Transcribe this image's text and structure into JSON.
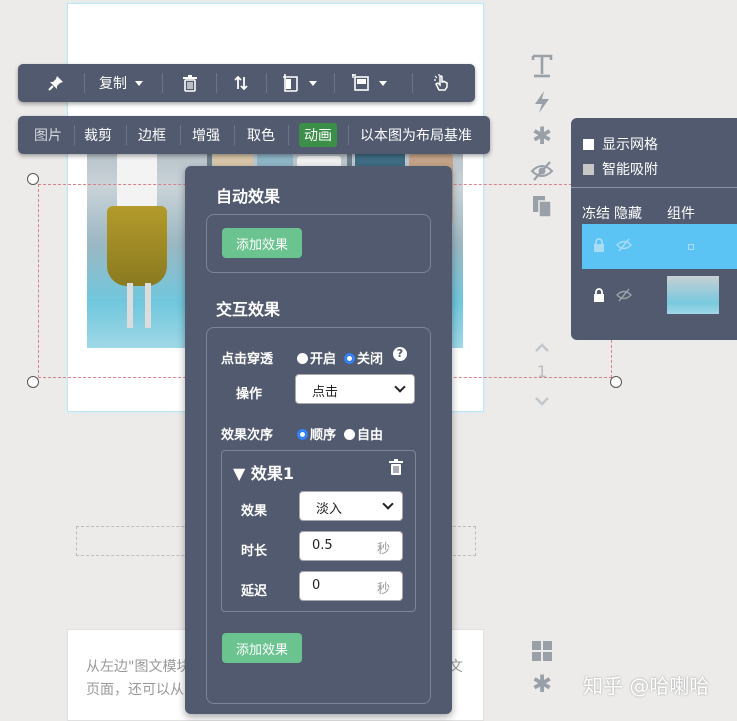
{
  "toolbar_top": {
    "pin_icon": "pin-icon",
    "copy_label": "复制",
    "delete_icon": "trash-icon",
    "order_icon": "sort-arrows-icon",
    "align_icon": "align-icon",
    "size_icon": "size-icon",
    "interact_icon": "hand-pointer-icon"
  },
  "toolbar_tabs": {
    "items": [
      "图片",
      "裁剪",
      "边框",
      "增强",
      "取色",
      "动画",
      "以本图为布局基准"
    ],
    "active": "动画"
  },
  "effects_panel": {
    "auto_title": "自动效果",
    "auto_add_button": "添加效果",
    "interactive_title": "交互效果",
    "click_through_label": "点击穿透",
    "on_label": "开启",
    "off_label": "关闭",
    "help_icon": "question-icon",
    "operation_label": "操作",
    "operation_value": "点击",
    "order_label": "效果次序",
    "order_sequential": "顺序",
    "order_free": "自由",
    "effect_title": "▼ 效果1",
    "effect_label": "效果",
    "effect_value": "淡入",
    "duration_label": "时长",
    "duration_value": "0.5",
    "delay_label": "延迟",
    "delay_value": "0",
    "seconds_unit": "秒",
    "add_button": "添加效果"
  },
  "layers_panel": {
    "show_grid": "显示网格",
    "smart_snap": "智能吸附",
    "col_freeze": "冻结",
    "col_hide": "隐藏",
    "col_component": "组件",
    "selected_row_color": "#5bc4f5"
  },
  "side_icons": [
    "text-icon",
    "lightning-icon",
    "asterisk-icon",
    "eye-slash-icon",
    "copy-icon",
    "chevron-up-icon",
    "chevron-down-icon",
    "grid-icon",
    "asterisk-icon"
  ],
  "side_number": "1",
  "text_card": {
    "body": "从左边\"图文模块\"中拖动内容到这里，然后在右侧编辑长图文页面，还可以从图文收藏里取出已经排版好的内容"
  },
  "watermark": "知乎 @哈喇哈"
}
